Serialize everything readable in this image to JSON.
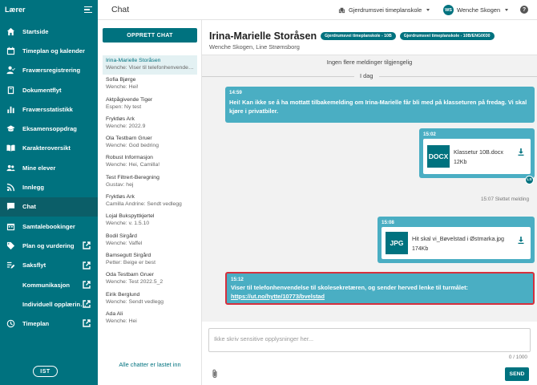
{
  "sidebar": {
    "title": "Lærer",
    "items": [
      {
        "label": "Startside",
        "icon": "home-icon"
      },
      {
        "label": "Timeplan og kalender",
        "icon": "calendar-icon"
      },
      {
        "label": "Fraværsregistrering",
        "icon": "person-check-icon"
      },
      {
        "label": "Dokumentflyt",
        "icon": "book-icon"
      },
      {
        "label": "Fraværsstatistikk",
        "icon": "bar-chart-icon"
      },
      {
        "label": "Eksamensoppdrag",
        "icon": "graduation-cap-icon"
      },
      {
        "label": "Karakteroversikt",
        "icon": "open-book-icon"
      },
      {
        "label": "Mine elever",
        "icon": "group-icon"
      },
      {
        "label": "Innlegg",
        "icon": "rss-icon"
      },
      {
        "label": "Chat",
        "icon": "chat-icon"
      },
      {
        "label": "Samtalebookinger",
        "icon": "calendar-clock-icon"
      },
      {
        "label": "Plan og vurdering",
        "icon": "tag-icon"
      },
      {
        "label": "Saksflyt",
        "icon": "list-edit-icon"
      },
      {
        "label": "Kommunikasjon",
        "icon": ""
      },
      {
        "label": "Individuell opplærin…",
        "icon": ""
      },
      {
        "label": "Timeplan",
        "icon": "clock-icon"
      }
    ],
    "logo": "IST"
  },
  "topbar": {
    "title": "Chat",
    "school": "Gjerdrumsvei timeplanskole",
    "user_initials": "WS",
    "user_name": "Wenche Skogen",
    "help": "?"
  },
  "chatlist": {
    "new_chat_label": "OPPRETT CHAT",
    "items": [
      {
        "name": "Irina-Marielle Storåsen",
        "preview": "Wenche: Viser til telefonhenvendelse til skolesekretæren"
      },
      {
        "name": "Sofia Bjørge",
        "preview": "Wenche: Hei!"
      },
      {
        "name": "Aktpågivende Tiger",
        "preview": "Espen: Ny test"
      },
      {
        "name": "Fryktløs Ark",
        "preview": "Wenche: 2022.9"
      },
      {
        "name": "Ola Testbarn Gruer",
        "preview": "Wenche: God bedring"
      },
      {
        "name": "Robust Informasjon",
        "preview": "Wenche: Hei, Camilla!"
      },
      {
        "name": "Test Filtrert-Beregning",
        "preview": "Gustav: hej"
      },
      {
        "name": "Fryktløs Ark",
        "preview": "Camilla Andrine: Sendt vedlegg"
      },
      {
        "name": "Lojal Bukspyttkjertel",
        "preview": "Wenche: v. 1.5.10"
      },
      {
        "name": "Bodil Sirgård",
        "preview": "Wenche: Vaffel"
      },
      {
        "name": "Bamsegutt Sirgård",
        "preview": "Petter: Beige er best"
      },
      {
        "name": "Oda Testbarn Gruer",
        "preview": "Wenche: Test 2022.5_2"
      },
      {
        "name": "Eirik Berglund",
        "preview": "Wenche: Sendt vedlegg"
      },
      {
        "name": "Ada Ali",
        "preview": "Wenche: Hei"
      }
    ],
    "footer": "Alle chatter er lastet inn"
  },
  "conversation": {
    "name": "Irina-Marielle Storåsen",
    "badges": [
      "Gjerdrumsvei timeplanskole - 10B",
      "Gjerdrumsvei timeplanskole - 10B/ENG0030"
    ],
    "participants": "Wenche Skogen, Line Strømsborg",
    "no_more": "Ingen flere meldinger tilgjengelig",
    "day": "I dag",
    "messages": [
      {
        "time": "14:59",
        "text": "Hei! Kan ikke se å ha mottatt tilbakemelding om Irina-Marielle får bli med på klasseturen på fredag. Vi skal kjøre i privatbiler."
      },
      {
        "time": "15:02",
        "file_type": "DOCX",
        "file_name": "Klassetur 10B.docx",
        "file_size": "12Kb",
        "read_badge": "LS"
      },
      {
        "deleted": "15:07 Slettet melding"
      },
      {
        "time": "15:08",
        "file_type": "JPG",
        "file_name": "Hit skal vi_Bøvelstad i Østmarka.jpg",
        "file_size": "174Kb"
      },
      {
        "time": "15:12",
        "text": "Viser til telefonhenvendelse til skolesekretæren, og sender herved lenke til turmålet:",
        "link": "https://ut.no/hytte/10773/bvelstad"
      }
    ]
  },
  "composer": {
    "placeholder": "Ikke skriv sensitive opplysninger her...",
    "counter": "0 / 1000",
    "send_label": "SEND"
  },
  "colors": {
    "primary": "#00727f",
    "bubble": "#4aaec3",
    "highlight_border": "#d6303d"
  }
}
